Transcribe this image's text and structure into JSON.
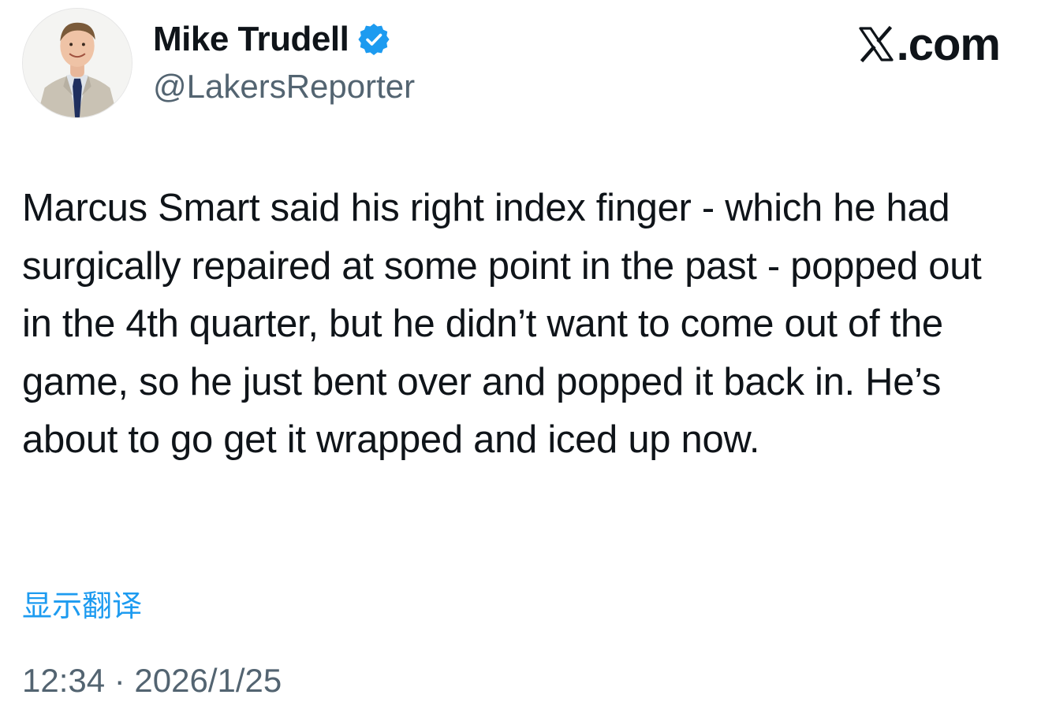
{
  "author": {
    "display_name": "Mike Trudell",
    "handle": "@LakersReporter",
    "verified": true,
    "verified_color": "#1d9bf0",
    "avatar_icon": "person-photo"
  },
  "brand": {
    "icon": "x-logo-icon",
    "label": ".com"
  },
  "tweet": {
    "text": "Marcus Smart said his right index finger - which he had surgically repaired at some point in the past - popped out in the 4th quarter, but he didn’t want to come out of the game, so he just bent over and popped it back in. He’s about to go get it wrapped and iced up now."
  },
  "translate": {
    "label": "显示翻译",
    "color": "#1d9bf0"
  },
  "meta": {
    "timestamp": "12:34 · 2026/1/25"
  }
}
